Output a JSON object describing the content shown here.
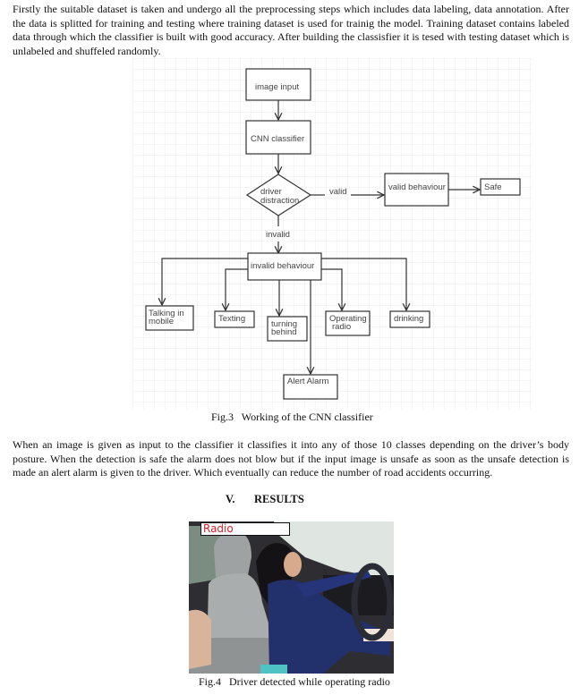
{
  "paragraphs": {
    "intro": "Firstly the suitable dataset is taken and undergo all the preprocessing steps which includes data labeling, data annotation. After the data is splitted for training and testing where training dataset is used for trainig the model. Training dataset contains labeled data through which the classifier is built with good accuracy. After building the classisfier it is tesed with testing dataset which is unlabeled and shuffeled randomly.",
    "explanation": "When an image is given as input to the classifier it classifies it into any of those 10 classes depending on the driver’s body posture. When the detection is safe the alarm does not blow but if the input image is unsafe as soon as the unsafe detection is made an alert alarm is given to the driver. Which eventually can reduce the number of road accidents occurring."
  },
  "figure3": {
    "caption": "Fig.3   Working of the CNN classifier",
    "nodes": {
      "image_input": "image input",
      "cnn_classifier": "CNN classifier",
      "decision_line1": "driver",
      "decision_line2": "distraction",
      "valid_behaviour": "valid behaviour",
      "safe": "Safe",
      "invalid_behaviour": "invalid behaviour",
      "talking_line1": "Talking in",
      "talking_line2": "mobile",
      "texting": "Texting",
      "turning_line1": "turning",
      "turning_line2": "behind",
      "radio_line1": "Operating",
      "radio_line2": "radio",
      "drinking": "drinking",
      "alert_alarm": "Alert Alarm"
    },
    "edge_labels": {
      "valid": "valid",
      "invalid": "invalid"
    }
  },
  "section_heading": {
    "number": "V.",
    "title": "RESULTS"
  },
  "figure4": {
    "detection_label": "Radio",
    "detection_label_color": "#d4202a",
    "caption": "Fig.4   Driver detected while operating radio"
  }
}
